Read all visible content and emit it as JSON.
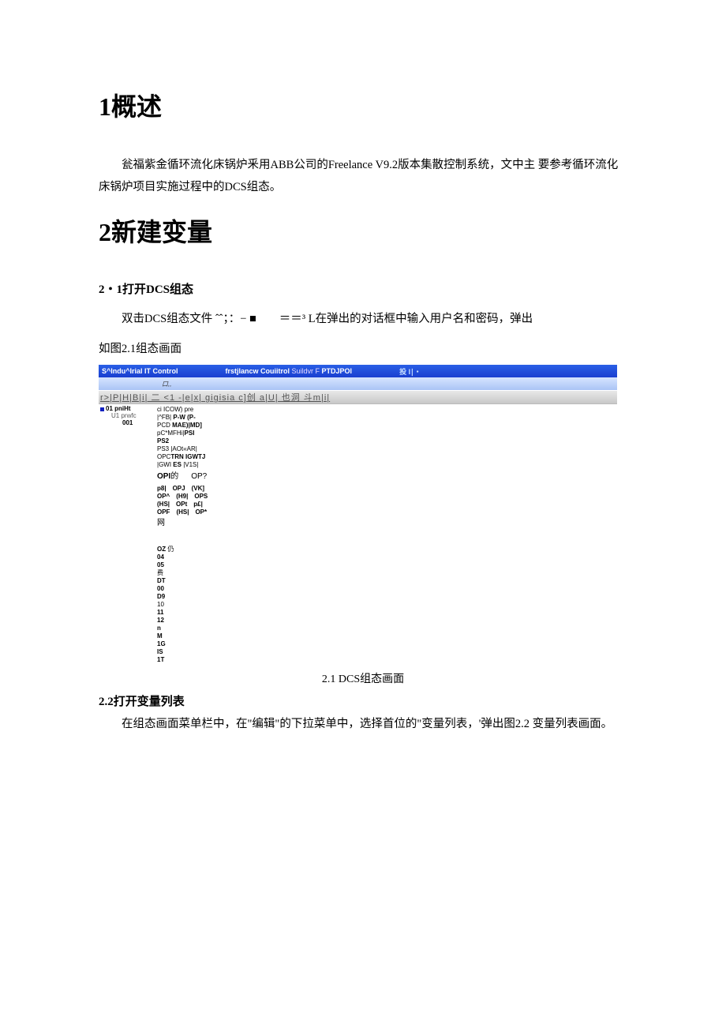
{
  "heading1": "1概述",
  "para1": "瓮福紫金循环流化床锅炉釆用ABB公司的Freelance V9.2版本集散控制系统，文中主 要参考循环流化床锅炉项目实施过程中的DCS组态。",
  "heading2": "2新建变量",
  "sec21_heading": "2・1打开DCS组态",
  "sec21_para": "双击DCS组态文件 ˆˆ；：− ■　　＝＝³ L在弹出的对话框中输入用户名和密码，弹出",
  "sec21_para2": "如图2.1组态画面",
  "app": {
    "titlebar": {
      "seg1": "S^Indu^Irial IT Control",
      "seg2a": "frstjlancw Couiitrol",
      "seg2b": " Suildvr F ",
      "seg2c": "PTDJPOl",
      "seg3": "投 I∣・"
    },
    "menubar": "口,,",
    "toolbar": "r>|P|H|B|i|  二 <1 -|e|x| gigisia c]创 a|U| 也洞 斗m|i|",
    "tree": {
      "root": "01 pniHt",
      "n1": "U1 prwfc",
      "n2": "001"
    },
    "detail_block1": [
      {
        "t": "ci ICOW)",
        "t2": " pre"
      },
      {
        "t": "|^FB| ",
        "b": "P-W (P-"
      },
      {
        "b": "MAE)",
        "t": " PCD ",
        "b2": "|MD]"
      },
      {
        "b": "PSI",
        "t": " pC*MFHi|"
      },
      {
        "b": "PS2"
      },
      {
        "t": "PS3 |AOt«AR|"
      },
      {
        "b": "TRN IGWTJ",
        "t": " OPC"
      },
      {
        "t": "|GWI ",
        "b": "ES",
        "t2": " |V1S|"
      }
    ],
    "detail_opi": {
      "left": "OPI",
      "mid": "的",
      "right": "OP?"
    },
    "detail_block2": [
      "p8|　OPJ　(VK]",
      "OP^　(H9|　OPS",
      "(HS|　OPt　p£|",
      "OPF　(HS|　OP*"
    ],
    "detail_net": "网",
    "detail_block3": [
      "OZ 仍",
      "04",
      "05",
      "费",
      "DT",
      "00",
      "D9",
      "10",
      "11",
      "12",
      "n",
      "M",
      "1G",
      "IS",
      "1T"
    ]
  },
  "fig_caption": "2.1 DCS组态画面",
  "sec22_heading": "2.2打开变量列表",
  "sec22_para": "在组态画面菜单栏中，在\"编辑\"的下拉菜单中，选择首位的\"变量列表，'弹出图2.2 变量列表画面。"
}
